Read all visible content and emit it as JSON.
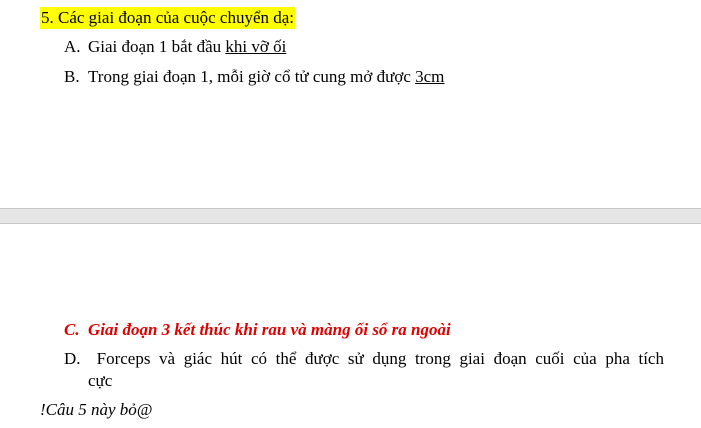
{
  "question": {
    "text": "5. Các giai đoạn của cuộc chuyển dạ:",
    "highlight_color": "#ffff00"
  },
  "options": {
    "a": {
      "letter": "A.",
      "text_before": "Giai đoạn 1 bắt đầu ",
      "underlined": "khi vỡ ối"
    },
    "b": {
      "letter": "B.",
      "text_before": "Trong giai đoạn 1, mỗi giờ cổ tử cung mở được ",
      "underlined": "3cm"
    },
    "c": {
      "letter": "C.",
      "text": "Giai đoạn 3 kết thúc khi rau và màng ối sổ ra ngoài",
      "color": "#e00000"
    },
    "d": {
      "letter": "D.",
      "line1_words": [
        "Forceps",
        "và",
        "giác",
        "hút",
        "có",
        "thể",
        "được",
        "sử",
        "dụng",
        "trong",
        "giai",
        "đoạn",
        "cuối",
        "của",
        "pha",
        "tích"
      ],
      "line2": "cực"
    }
  },
  "note": "!Câu 5 này bỏ@"
}
